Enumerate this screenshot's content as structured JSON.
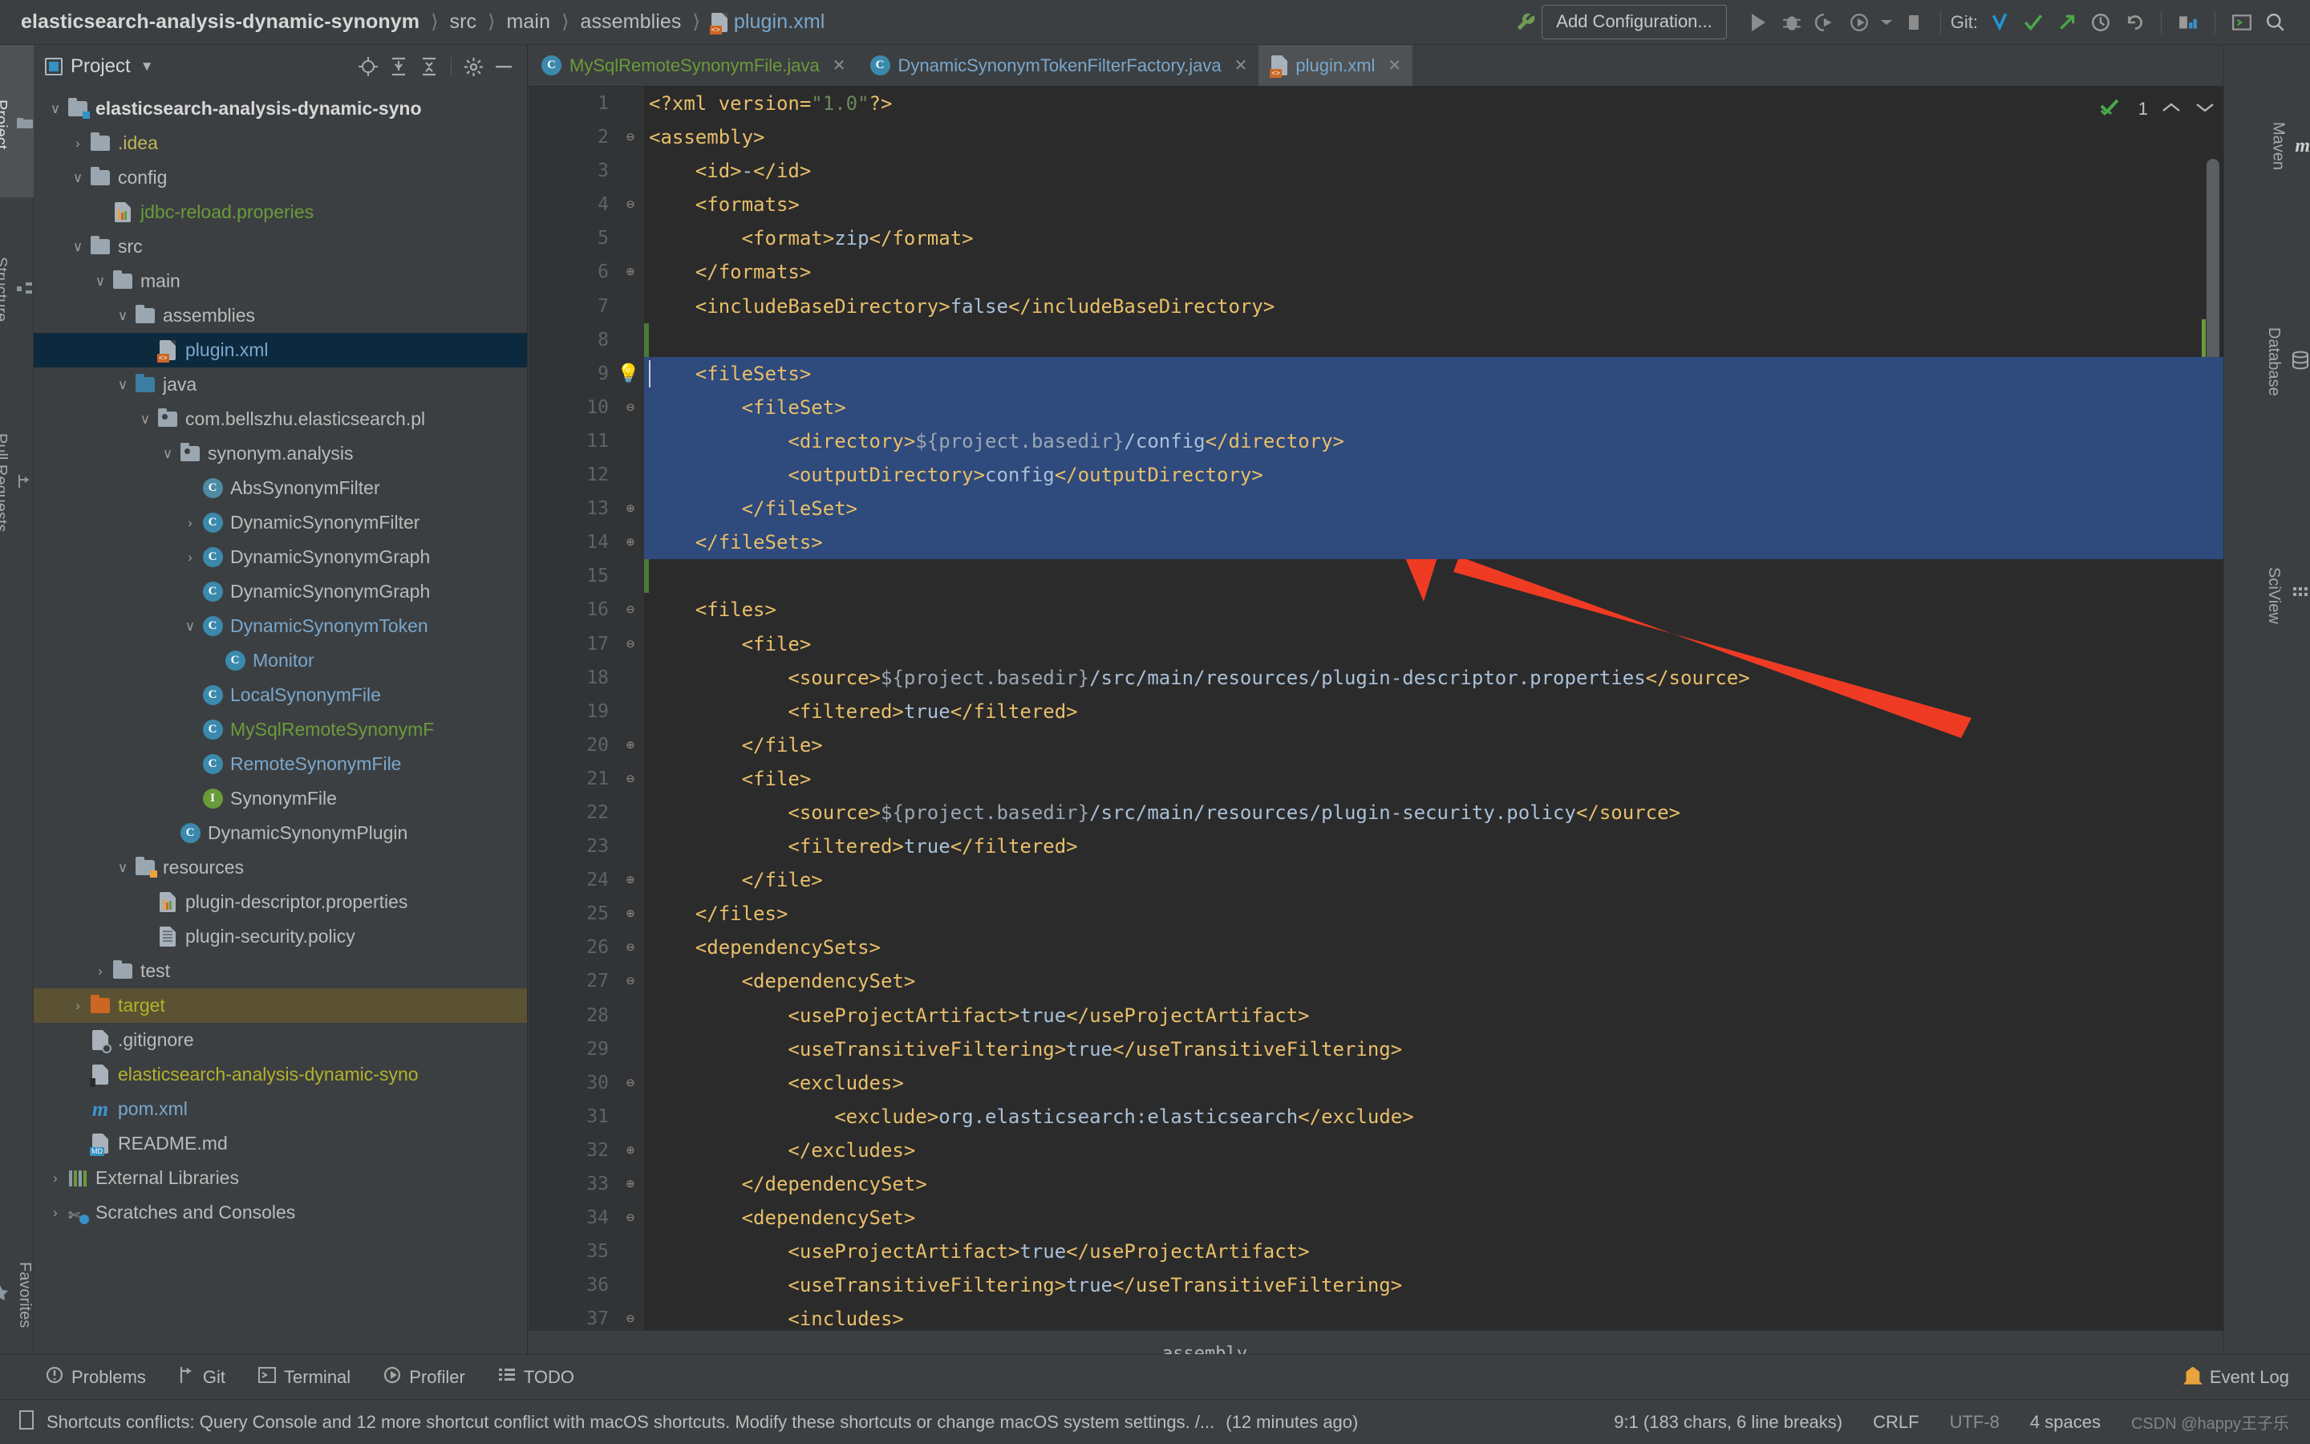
{
  "breadcrumb": {
    "items": [
      "elasticsearch-analysis-dynamic-synonym",
      "src",
      "main",
      "assemblies",
      "plugin.xml"
    ],
    "separator": "〉"
  },
  "toolbar": {
    "add_configuration": "Add Configuration...",
    "git_label": "Git:",
    "icons": [
      "wrench-icon",
      "run-icon",
      "debug-icon",
      "run-coverage-icon",
      "profile-icon",
      "dropdown-icon",
      "stop-icon",
      "git-update-icon",
      "git-commit-icon",
      "git-push-icon",
      "git-history-icon",
      "git-rollback-icon",
      "project-structure-icon",
      "terminal-icon",
      "search-everywhere-icon"
    ]
  },
  "left_rail": [
    {
      "label": "Project",
      "icon": "project-icon",
      "active": true
    },
    {
      "label": "Structure",
      "icon": "structure-icon",
      "active": false
    },
    {
      "label": "Pull Requests",
      "icon": "pull-requests-icon",
      "active": false
    },
    {
      "label": "Favorites",
      "icon": "star-icon",
      "active": false
    }
  ],
  "right_rail": [
    {
      "label": "Maven",
      "icon": "maven-icon"
    },
    {
      "label": "Database",
      "icon": "database-icon"
    },
    {
      "label": "SciView",
      "icon": "sciview-icon"
    }
  ],
  "project_panel": {
    "title": "Project",
    "header_icons": [
      "locate-icon",
      "expand-all-icon",
      "collapse-all-icon",
      "settings-gear-icon",
      "hide-icon"
    ],
    "tree": [
      {
        "label": "elasticsearch-analysis-dynamic-syno",
        "depth": 0,
        "arrow": "down",
        "icon": "module-folder-icon",
        "color": "white"
      },
      {
        "label": ".idea",
        "depth": 1,
        "arrow": "right",
        "icon": "folder-icon",
        "color": "yellow"
      },
      {
        "label": "config",
        "depth": 1,
        "arrow": "down",
        "icon": "folder-icon",
        "color": "grey"
      },
      {
        "label": "jdbc-reload.properies",
        "depth": 2,
        "arrow": "none",
        "icon": "properties-file-icon",
        "color": "green"
      },
      {
        "label": "src",
        "depth": 1,
        "arrow": "down",
        "icon": "folder-icon",
        "color": "grey"
      },
      {
        "label": "main",
        "depth": 2,
        "arrow": "down",
        "icon": "folder-icon",
        "color": "grey"
      },
      {
        "label": "assemblies",
        "depth": 3,
        "arrow": "down",
        "icon": "folder-icon",
        "color": "grey"
      },
      {
        "label": "plugin.xml",
        "depth": 4,
        "arrow": "none",
        "icon": "xml-file-icon",
        "color": "blue",
        "selected": true
      },
      {
        "label": "java",
        "depth": 3,
        "arrow": "down",
        "icon": "source-folder-icon",
        "color": "grey"
      },
      {
        "label": "com.bellszhu.elasticsearch.pl",
        "depth": 4,
        "arrow": "down",
        "icon": "package-icon",
        "color": "grey"
      },
      {
        "label": "synonym.analysis",
        "depth": 5,
        "arrow": "down",
        "icon": "package-icon",
        "color": "grey"
      },
      {
        "label": "AbsSynonymFilter",
        "depth": 6,
        "arrow": "none",
        "icon": "abstract-class-icon",
        "color": "grey"
      },
      {
        "label": "DynamicSynonymFilter",
        "depth": 6,
        "arrow": "right",
        "icon": "class-icon",
        "color": "grey"
      },
      {
        "label": "DynamicSynonymGraph",
        "depth": 6,
        "arrow": "right",
        "icon": "class-icon",
        "color": "grey"
      },
      {
        "label": "DynamicSynonymGraph",
        "depth": 6,
        "arrow": "none",
        "icon": "class-icon",
        "color": "grey"
      },
      {
        "label": "DynamicSynonymToken",
        "depth": 6,
        "arrow": "down",
        "icon": "class-icon",
        "color": "blue"
      },
      {
        "label": "Monitor",
        "depth": 7,
        "arrow": "none",
        "icon": "class-icon",
        "color": "blue"
      },
      {
        "label": "LocalSynonymFile",
        "depth": 6,
        "arrow": "none",
        "icon": "class-icon",
        "color": "blue"
      },
      {
        "label": "MySqlRemoteSynonymF",
        "depth": 6,
        "arrow": "none",
        "icon": "class-icon",
        "color": "green"
      },
      {
        "label": "RemoteSynonymFile",
        "depth": 6,
        "arrow": "none",
        "icon": "class-icon",
        "color": "blue"
      },
      {
        "label": "SynonymFile",
        "depth": 6,
        "arrow": "none",
        "icon": "interface-icon",
        "color": "grey"
      },
      {
        "label": "DynamicSynonymPlugin",
        "depth": 5,
        "arrow": "none",
        "icon": "class-icon",
        "color": "grey"
      },
      {
        "label": "resources",
        "depth": 3,
        "arrow": "down",
        "icon": "resources-folder-icon",
        "color": "grey"
      },
      {
        "label": "plugin-descriptor.properties",
        "depth": 4,
        "arrow": "none",
        "icon": "properties-file-icon",
        "color": "grey"
      },
      {
        "label": "plugin-security.policy",
        "depth": 4,
        "arrow": "none",
        "icon": "policy-file-icon",
        "color": "grey"
      },
      {
        "label": "test",
        "depth": 2,
        "arrow": "right",
        "icon": "folder-icon",
        "color": "grey"
      },
      {
        "label": "target",
        "depth": 1,
        "arrow": "right",
        "icon": "excluded-folder-icon",
        "color": "olive",
        "selected2": true
      },
      {
        "label": ".gitignore",
        "depth": 1,
        "arrow": "none",
        "icon": "gitignore-file-icon",
        "color": "grey"
      },
      {
        "label": "elasticsearch-analysis-dynamic-syno",
        "depth": 1,
        "arrow": "none",
        "icon": "iml-file-icon",
        "color": "olive"
      },
      {
        "label": "pom.xml",
        "depth": 1,
        "arrow": "none",
        "icon": "maven-file-icon",
        "color": "blue"
      },
      {
        "label": "README.md",
        "depth": 1,
        "arrow": "none",
        "icon": "markdown-file-icon",
        "color": "grey"
      },
      {
        "label": "External Libraries",
        "depth": 0,
        "arrow": "right",
        "icon": "libraries-icon",
        "color": "grey"
      },
      {
        "label": "Scratches and Consoles",
        "depth": 0,
        "arrow": "right",
        "icon": "scratches-icon",
        "color": "grey"
      }
    ]
  },
  "editor": {
    "tabs": [
      {
        "label": "MySqlRemoteSynonymFile.java",
        "icon": "class-icon",
        "color": "green",
        "active": false
      },
      {
        "label": "DynamicSynonymTokenFilterFactory.java",
        "icon": "class-icon",
        "color": "blue",
        "active": false
      },
      {
        "label": "plugin.xml",
        "icon": "xml-file-icon",
        "color": "grey",
        "active": true
      }
    ],
    "inspection": {
      "count": "1",
      "icon": "inspection-ok-icon",
      "up": "⌃",
      "down": "⌄"
    },
    "breadcrumb": "assembly",
    "lines": [
      {
        "n": 1,
        "fold": "",
        "text": "<?xml version=\"1.0\"?>",
        "tokens": [
          {
            "t": "tag",
            "v": "<?xml "
          },
          {
            "t": "attr",
            "v": "version="
          },
          {
            "t": "str",
            "v": "\"1.0\""
          },
          {
            "t": "tag",
            "v": "?>"
          }
        ]
      },
      {
        "n": 2,
        "fold": "minus",
        "text": "<assembly>"
      },
      {
        "n": 3,
        "fold": "",
        "text": "    <id>-</id>"
      },
      {
        "n": 4,
        "fold": "minus",
        "text": "    <formats>"
      },
      {
        "n": 5,
        "fold": "",
        "text": "        <format>zip</format>"
      },
      {
        "n": 6,
        "fold": "end",
        "text": "    </formats>"
      },
      {
        "n": 7,
        "fold": "",
        "text": "    <includeBaseDirectory>false</includeBaseDirectory>"
      },
      {
        "n": 8,
        "fold": "",
        "text": ""
      },
      {
        "n": 9,
        "fold": "minus",
        "text": "    <fileSets>",
        "hl": true,
        "bulb": true
      },
      {
        "n": 10,
        "fold": "minus",
        "text": "        <fileSet>",
        "hl": true
      },
      {
        "n": 11,
        "fold": "",
        "text": "            <directory>${project.basedir}/config</directory>",
        "hl": true
      },
      {
        "n": 12,
        "fold": "",
        "text": "            <outputDirectory>config</outputDirectory>",
        "hl": true
      },
      {
        "n": 13,
        "fold": "end",
        "text": "        </fileSet>",
        "hl": true
      },
      {
        "n": 14,
        "fold": "end",
        "text": "    </fileSets>",
        "hl": true
      },
      {
        "n": 15,
        "fold": "",
        "text": ""
      },
      {
        "n": 16,
        "fold": "minus",
        "text": "    <files>"
      },
      {
        "n": 17,
        "fold": "minus",
        "text": "        <file>"
      },
      {
        "n": 18,
        "fold": "",
        "text": "            <source>${project.basedir}/src/main/resources/plugin-descriptor.properties</source>"
      },
      {
        "n": 19,
        "fold": "",
        "text": "            <filtered>true</filtered>"
      },
      {
        "n": 20,
        "fold": "end",
        "text": "        </file>"
      },
      {
        "n": 21,
        "fold": "minus",
        "text": "        <file>"
      },
      {
        "n": 22,
        "fold": "",
        "text": "            <source>${project.basedir}/src/main/resources/plugin-security.policy</source>"
      },
      {
        "n": 23,
        "fold": "",
        "text": "            <filtered>true</filtered>"
      },
      {
        "n": 24,
        "fold": "end",
        "text": "        </file>"
      },
      {
        "n": 25,
        "fold": "end",
        "text": "    </files>"
      },
      {
        "n": 26,
        "fold": "minus",
        "text": "    <dependencySets>"
      },
      {
        "n": 27,
        "fold": "minus",
        "text": "        <dependencySet>"
      },
      {
        "n": 28,
        "fold": "",
        "text": "            <useProjectArtifact>true</useProjectArtifact>"
      },
      {
        "n": 29,
        "fold": "",
        "text": "            <useTransitiveFiltering>true</useTransitiveFiltering>"
      },
      {
        "n": 30,
        "fold": "minus",
        "text": "            <excludes>"
      },
      {
        "n": 31,
        "fold": "",
        "text": "                <exclude>org.elasticsearch:elasticsearch</exclude>"
      },
      {
        "n": 32,
        "fold": "end",
        "text": "            </excludes>"
      },
      {
        "n": 33,
        "fold": "end",
        "text": "        </dependencySet>"
      },
      {
        "n": 34,
        "fold": "minus",
        "text": "        <dependencySet>"
      },
      {
        "n": 35,
        "fold": "",
        "text": "            <useProjectArtifact>true</useProjectArtifact>"
      },
      {
        "n": 36,
        "fold": "",
        "text": "            <useTransitiveFiltering>true</useTransitiveFiltering>"
      },
      {
        "n": 37,
        "fold": "minus",
        "text": "            <includes>"
      }
    ]
  },
  "bottom_bar": {
    "buttons": [
      {
        "label": "Problems",
        "icon": "problems-icon"
      },
      {
        "label": "Git",
        "icon": "git-icon"
      },
      {
        "label": "Terminal",
        "icon": "terminal-icon"
      },
      {
        "label": "Profiler",
        "icon": "profiler-icon"
      },
      {
        "label": "TODO",
        "icon": "todo-icon"
      }
    ],
    "event_log": "Event Log"
  },
  "status_bar": {
    "message": "Shortcuts conflicts: Query Console and 12 more shortcut conflict with macOS shortcuts. Modify these shortcuts or change macOS system settings. /...",
    "time": "(12 minutes ago)",
    "caret": "9:1 (183 chars, 6 line breaks)",
    "line_sep": "CRLF",
    "encoding": "UTF-8",
    "indent": "4 spaces",
    "watermark": "CSDN @happy王子乐"
  },
  "colors": {
    "accent_blue": "#3592c4",
    "selection": "#2f4a7c",
    "tree_selection": "#0d293e",
    "arrow_red": "#ef3b24",
    "tag_yellow": "#e8bf6a",
    "string_green": "#6a8759",
    "value_blue": "#a9c0d8"
  }
}
